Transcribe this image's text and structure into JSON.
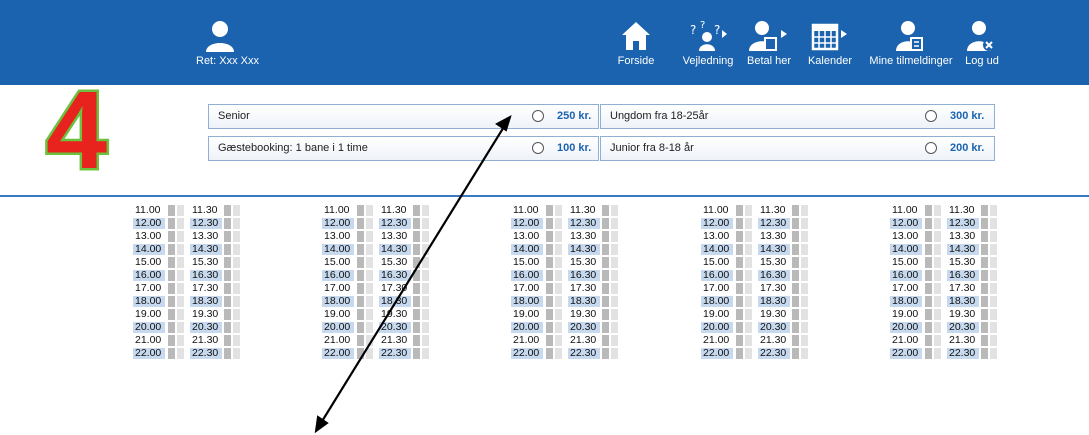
{
  "header": {
    "user_label": "Ret: Xxx Xxx",
    "nav": [
      {
        "label": "Forside",
        "icon": "home-icon"
      },
      {
        "label": "Vejledning",
        "icon": "help-icon"
      },
      {
        "label": "Betal her",
        "icon": "payment-icon"
      },
      {
        "label": "Kalender",
        "icon": "calendar-icon"
      },
      {
        "label": "Mine tilmeldinger",
        "icon": "registrations-icon"
      },
      {
        "label": "Log ud",
        "icon": "logout-icon"
      }
    ]
  },
  "step_number": "4",
  "prices": [
    {
      "name": "Senior",
      "amount": "250 kr."
    },
    {
      "name": "Ungdom fra 18-25år",
      "amount": "300 kr."
    },
    {
      "name": "Gæstebooking: 1 bane i 1 time",
      "amount": "100 kr."
    },
    {
      "name": "Junior fra 8-18 år",
      "amount": "200 kr."
    }
  ],
  "schedule": {
    "columns": 5,
    "rows": [
      {
        "start": "11.00",
        "end": "11.30"
      },
      {
        "start": "12.00",
        "end": "12.30"
      },
      {
        "start": "13.00",
        "end": "13.30"
      },
      {
        "start": "14.00",
        "end": "14.30"
      },
      {
        "start": "15.00",
        "end": "15.30"
      },
      {
        "start": "16.00",
        "end": "16.30"
      },
      {
        "start": "17.00",
        "end": "17.30"
      },
      {
        "start": "18.00",
        "end": "18.30"
      },
      {
        "start": "19.00",
        "end": "19.30"
      },
      {
        "start": "20.00",
        "end": "20.30"
      },
      {
        "start": "21.00",
        "end": "21.30"
      },
      {
        "start": "22.00",
        "end": "22.30"
      }
    ]
  },
  "colors": {
    "header_bg": "#1b63ae",
    "accent_amount": "#1b63ae",
    "slot_highlight": "#c6d9ee",
    "step_fill": "#e8221c",
    "step_outline": "#6cc13d"
  }
}
